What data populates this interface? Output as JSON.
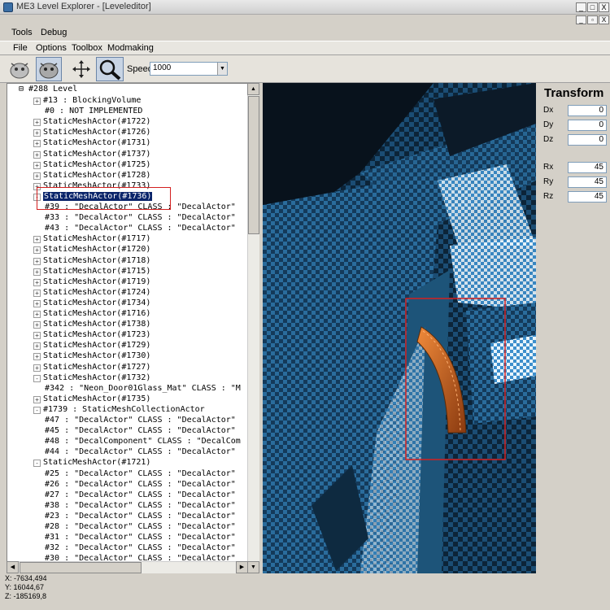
{
  "window": {
    "title": "ME3 Level Explorer - [Leveleditor]",
    "buttons": [
      "_",
      "□",
      "X"
    ]
  },
  "menu": [
    "Tools",
    "Debug"
  ],
  "child_menu": [
    "File",
    "Options",
    "Toolbox",
    "Modmaking"
  ],
  "child_controls": [
    "_",
    "▫",
    "X"
  ],
  "toolbar": {
    "speed_label": "Speed:",
    "speed_value": "1000"
  },
  "tree": {
    "root": "⊟ #288 Level",
    "rows": [
      {
        "indent": 1,
        "exp": "+",
        "label": "#13 : BlockingVolume"
      },
      {
        "indent": 2,
        "exp": "",
        "label": "#0 : NOT IMPLEMENTED"
      },
      {
        "indent": 1,
        "exp": "+",
        "label": "StaticMeshActor(#1722)"
      },
      {
        "indent": 1,
        "exp": "+",
        "label": "StaticMeshActor(#1726)"
      },
      {
        "indent": 1,
        "exp": "+",
        "label": "StaticMeshActor(#1731)"
      },
      {
        "indent": 1,
        "exp": "+",
        "label": "StaticMeshActor(#1737)"
      },
      {
        "indent": 1,
        "exp": "+",
        "label": "StaticMeshActor(#1725)"
      },
      {
        "indent": 1,
        "exp": "+",
        "label": "StaticMeshActor(#1728)"
      },
      {
        "indent": 1,
        "exp": "+",
        "label": "StaticMeshActor(#1733)"
      },
      {
        "indent": 1,
        "exp": "-",
        "label": "StaticMeshActor(#1736)",
        "selected": true
      },
      {
        "indent": 2,
        "exp": "",
        "label": "#39 : \"DecalActor\" CLASS : \"DecalActor\""
      },
      {
        "indent": 2,
        "exp": "",
        "label": "#33 : \"DecalActor\" CLASS : \"DecalActor\""
      },
      {
        "indent": 2,
        "exp": "",
        "label": "#43 : \"DecalActor\" CLASS : \"DecalActor\""
      },
      {
        "indent": 1,
        "exp": "+",
        "label": "StaticMeshActor(#1717)"
      },
      {
        "indent": 1,
        "exp": "+",
        "label": "StaticMeshActor(#1720)"
      },
      {
        "indent": 1,
        "exp": "+",
        "label": "StaticMeshActor(#1718)"
      },
      {
        "indent": 1,
        "exp": "+",
        "label": "StaticMeshActor(#1715)"
      },
      {
        "indent": 1,
        "exp": "+",
        "label": "StaticMeshActor(#1719)"
      },
      {
        "indent": 1,
        "exp": "+",
        "label": "StaticMeshActor(#1724)"
      },
      {
        "indent": 1,
        "exp": "+",
        "label": "StaticMeshActor(#1734)"
      },
      {
        "indent": 1,
        "exp": "+",
        "label": "StaticMeshActor(#1716)"
      },
      {
        "indent": 1,
        "exp": "+",
        "label": "StaticMeshActor(#1738)"
      },
      {
        "indent": 1,
        "exp": "+",
        "label": "StaticMeshActor(#1723)"
      },
      {
        "indent": 1,
        "exp": "+",
        "label": "StaticMeshActor(#1729)"
      },
      {
        "indent": 1,
        "exp": "+",
        "label": "StaticMeshActor(#1730)"
      },
      {
        "indent": 1,
        "exp": "+",
        "label": "StaticMeshActor(#1727)"
      },
      {
        "indent": 1,
        "exp": "-",
        "label": "StaticMeshActor(#1732)"
      },
      {
        "indent": 2,
        "exp": "",
        "label": "#342 : \"Neon_Door01Glass_Mat\" CLASS : \"M"
      },
      {
        "indent": 1,
        "exp": "+",
        "label": "StaticMeshActor(#1735)"
      },
      {
        "indent": 1,
        "exp": "-",
        "label": "#1739 : StaticMeshCollectionActor"
      },
      {
        "indent": 2,
        "exp": "",
        "label": "#47 : \"DecalActor\" CLASS : \"DecalActor\""
      },
      {
        "indent": 2,
        "exp": "",
        "label": "#45 : \"DecalActor\" CLASS : \"DecalActor\""
      },
      {
        "indent": 2,
        "exp": "",
        "label": "#48 : \"DecalComponent\" CLASS : \"DecalCom"
      },
      {
        "indent": 2,
        "exp": "",
        "label": "#44 : \"DecalActor\" CLASS : \"DecalActor\""
      },
      {
        "indent": 1,
        "exp": "-",
        "label": "StaticMeshActor(#1721)"
      },
      {
        "indent": 2,
        "exp": "",
        "label": "#25 : \"DecalActor\" CLASS : \"DecalActor\""
      },
      {
        "indent": 2,
        "exp": "",
        "label": "#26 : \"DecalActor\" CLASS : \"DecalActor\""
      },
      {
        "indent": 2,
        "exp": "",
        "label": "#27 : \"DecalActor\" CLASS : \"DecalActor\""
      },
      {
        "indent": 2,
        "exp": "",
        "label": "#38 : \"DecalActor\" CLASS : \"DecalActor\""
      },
      {
        "indent": 2,
        "exp": "",
        "label": "#23 : \"DecalActor\" CLASS : \"DecalActor\""
      },
      {
        "indent": 2,
        "exp": "",
        "label": "#28 : \"DecalActor\" CLASS : \"DecalActor\""
      },
      {
        "indent": 2,
        "exp": "",
        "label": "#31 : \"DecalActor\" CLASS : \"DecalActor\""
      },
      {
        "indent": 2,
        "exp": "",
        "label": "#32 : \"DecalActor\" CLASS : \"DecalActor\""
      },
      {
        "indent": 2,
        "exp": "",
        "label": "#30 : \"DecalActor\" CLASS : \"DecalActor\""
      }
    ]
  },
  "transform": {
    "title": "Transform",
    "fields": [
      {
        "label": "Dx",
        "value": "0"
      },
      {
        "label": "Dy",
        "value": "0"
      },
      {
        "label": "Dz",
        "value": "0"
      },
      {
        "label": "Rx",
        "value": "45"
      },
      {
        "label": "Ry",
        "value": "45"
      },
      {
        "label": "Rz",
        "value": "45"
      }
    ]
  },
  "status": {
    "x": "X: -7634,494",
    "y": "Y: 16044,67",
    "z": "Z: -185169,8"
  },
  "colors": {
    "selection": "#0a246a",
    "highlight_box": "#d32020",
    "mesh_orange": "#d8691f",
    "checker_blue": "#5aa7d8"
  },
  "icons": [
    "app-icon",
    "orbit-camera-icon",
    "pan-camera-icon",
    "move-icon",
    "zoom-icon"
  ]
}
